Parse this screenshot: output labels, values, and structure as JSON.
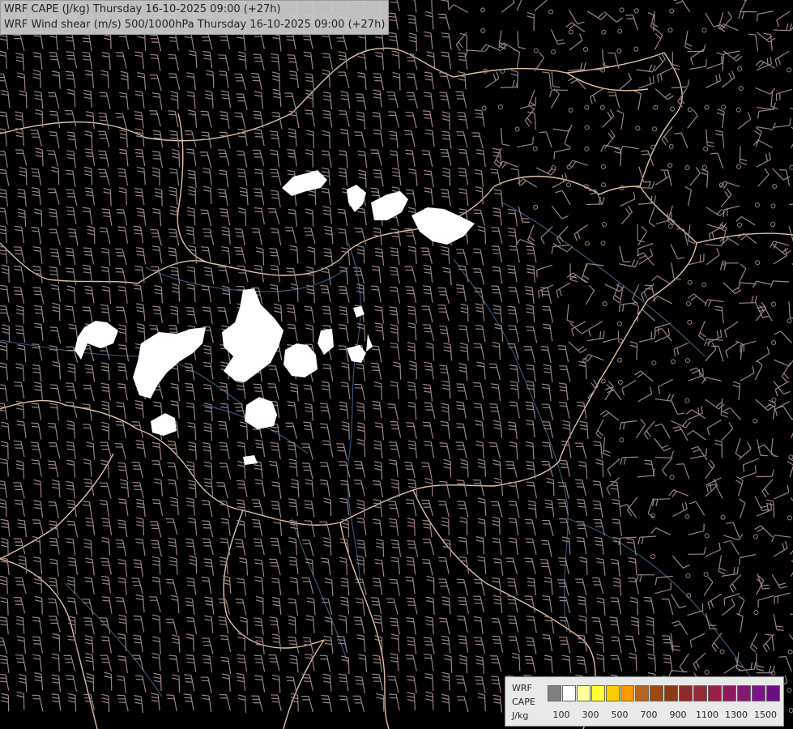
{
  "title": {
    "line1": "WRF CAPE (J/kg) Thursday 16-10-2025 09:00 (+27h)",
    "line2": "WRF Wind shear (m/s) 500/1000hPa Thursday 16-10-2025 09:00 (+27h)"
  },
  "legend": {
    "label_lines": [
      "WRF",
      "CAPE",
      "J/kg"
    ],
    "colors": [
      "#7f7f7f",
      "#ffffff",
      "#ffff99",
      "#ffff33",
      "#ffcc00",
      "#ff9900",
      "#b8641e",
      "#9b4a10",
      "#8b3a14",
      "#8f2a2a",
      "#962a3a",
      "#9a2048",
      "#8e1a5c",
      "#861874",
      "#7a1684",
      "#6a0f7e"
    ],
    "tick_labels": [
      "100",
      "300",
      "500",
      "700",
      "900",
      "1100",
      "1300",
      "1500"
    ]
  },
  "map_colors": {
    "background": "#000000",
    "border": "#e2c3a3",
    "river": "#3e5a86",
    "barb": "#9d8488",
    "cape_area": "#ffffff"
  }
}
